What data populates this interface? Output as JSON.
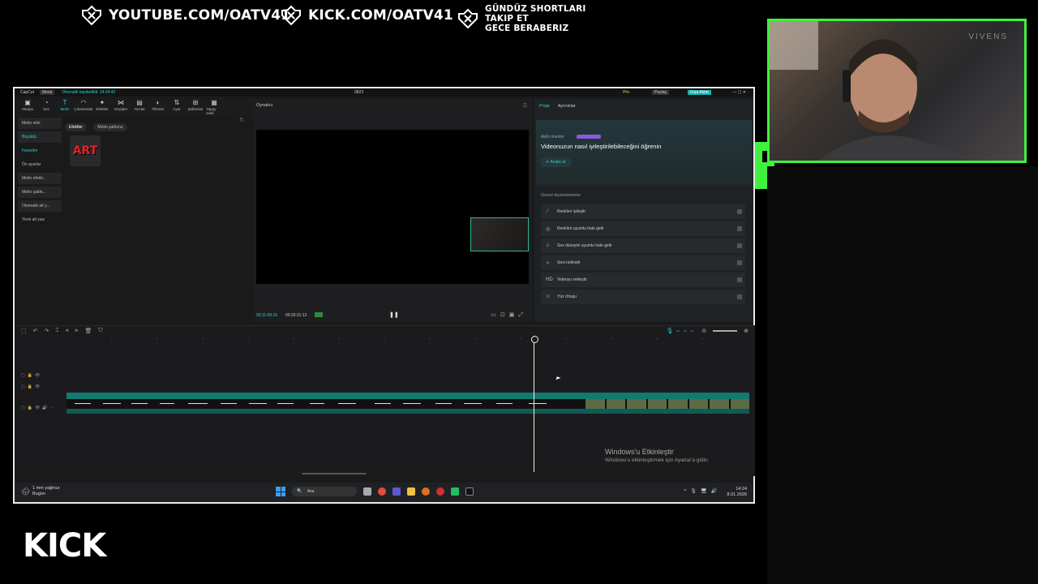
{
  "banner": {
    "youtube": "YOUTUBE.COM/OATV41",
    "kick": "KICK.COM/OATV41",
    "shorts_line1": "GÜNDÜZ SHORTLARI",
    "shorts_line2": "TAKIP ET",
    "shorts_line3": "GECE BERABERIZ"
  },
  "kick_logo": "KICK",
  "camera": {
    "overlay_text": "VIVENS"
  },
  "app": {
    "name": "CapCut",
    "menu": "Menü",
    "autosave": "Otomatik kaydedildi: 14:24:42",
    "project_title": "0823",
    "pro_label": "Pro",
    "share_label": "Paylaş",
    "export_label": "Dışa Aktar"
  },
  "toolbar": [
    {
      "label": "Medya",
      "icon": "media-icon"
    },
    {
      "label": "Ses",
      "icon": "audio-icon"
    },
    {
      "label": "Metin",
      "icon": "text-icon",
      "active": true
    },
    {
      "label": "Çıkartmalar",
      "icon": "sticker-icon"
    },
    {
      "label": "Efektler",
      "icon": "effects-icon"
    },
    {
      "label": "Geçişler",
      "icon": "transitions-icon"
    },
    {
      "label": "Yazılar",
      "icon": "captions-icon"
    },
    {
      "label": "Filtreler",
      "icon": "filters-icon"
    },
    {
      "label": "Ayar",
      "icon": "adjust-icon"
    },
    {
      "label": "Şablonlar",
      "icon": "templates-icon"
    },
    {
      "label": "Yapay zekâ",
      "icon": "ai-icon"
    }
  ],
  "leftnav": [
    "Metin ekle",
    "Büyüklü",
    "Favoriler",
    "Ön ayarlar",
    "Metin efekti...",
    "Metin şablo...",
    "Otomatik alt y...",
    "Yerel alt yazı"
  ],
  "media_tabs": [
    "Efektler",
    "Metin şablonu"
  ],
  "sticker_art": "ART",
  "player": {
    "title": "Oynatıcı",
    "time_current": "00:11:09:16",
    "time_total": "00:26:31:12"
  },
  "props": {
    "tab_project": "Proje",
    "tab_details": "Ayrıntılar",
    "ai_label": "Akıllı öneriler",
    "ai_title": "Videonuzun nasıl iyileştirilebileceğini öğrenin",
    "analyze": "Analiz et",
    "general_head": "Genel düzenlemeler",
    "rows": [
      {
        "label": "Renkleri iyileştir",
        "icon": "color-wand-icon"
      },
      {
        "label": "Renkleri uyumlu hale getir",
        "icon": "color-match-icon"
      },
      {
        "label": "Ses düzeyini uyumlu hale getir",
        "icon": "volume-icon"
      },
      {
        "label": "Sesi netleştir",
        "icon": "voice-icon"
      },
      {
        "label": "Videoyu netleştir",
        "icon": "hd-icon"
      },
      {
        "label": "Yüz rötuşu",
        "icon": "face-icon"
      }
    ]
  },
  "watermark": {
    "line1": "Windows'u Etkinleştir",
    "line2": "Windows'u etkinleştirmek için Ayarlar'a gidin."
  },
  "taskbar": {
    "weather_line1": "1 mm yağmur",
    "weather_line2": "Bugün",
    "search": "Ara",
    "time": "14:24",
    "date": "8.01.2026"
  }
}
